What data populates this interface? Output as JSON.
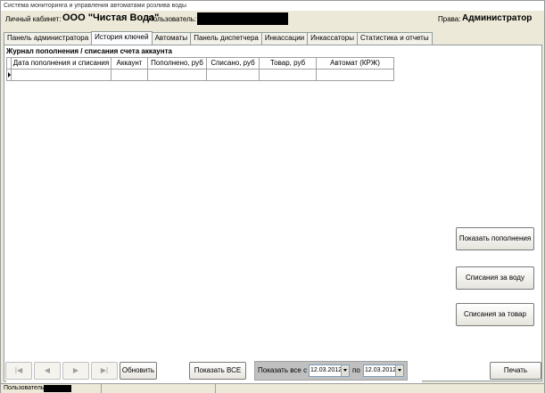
{
  "window": {
    "title": "Система мониторинга и управления автоматами розлива воды"
  },
  "header": {
    "cabinet_label": "Личный кабинет:",
    "cabinet_name": "ООО \"Чистая Вода\"",
    "user_label": "Пользователь:",
    "rights_label": "Права:",
    "rights_value": "Администратор"
  },
  "tabs": [
    {
      "label": "Панель администратора",
      "active": false
    },
    {
      "label": "История ключей",
      "active": true
    },
    {
      "label": "Автоматы",
      "active": false
    },
    {
      "label": "Панель диспетчера",
      "active": false
    },
    {
      "label": "Инкассации",
      "active": false
    },
    {
      "label": "Инкассаторы",
      "active": false
    },
    {
      "label": "Статистика и отчеты",
      "active": false
    }
  ],
  "journal": {
    "title": "Журнал пополнения / списания счета аккаунта",
    "columns": [
      "Дата пополнения и списания",
      "Аккаунт",
      "Пополнено, руб",
      "Списано, руб",
      "Товар, руб",
      "Автомат (КРЖ)"
    ]
  },
  "side_buttons": {
    "show_topups": "Показать пополнения",
    "water_charges": "Списания за воду",
    "goods_charges": "Списания за товар"
  },
  "bottom": {
    "nav": [
      "|◀",
      "◀",
      "▶",
      "▶|"
    ],
    "refresh": "Обновить",
    "show_all": "Показать ВСЕ",
    "show_all_from": "Показать все с",
    "to": "по",
    "date_from": "12.03.2012",
    "date_to": "12.03.2012",
    "print": "Печать"
  },
  "status": {
    "user_label": "Пользователь:"
  }
}
